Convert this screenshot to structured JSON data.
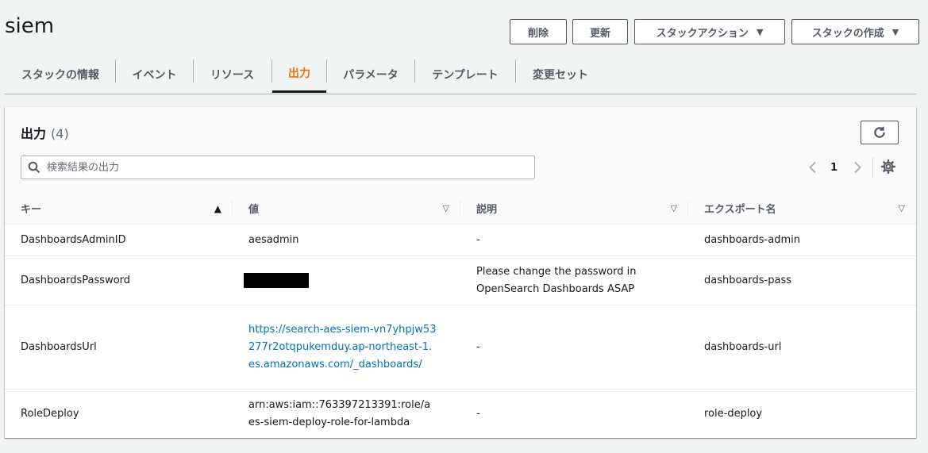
{
  "page": {
    "title": "siem"
  },
  "actions": {
    "delete": "削除",
    "update": "更新",
    "stack_actions": "スタックアクション",
    "create_stack": "スタックの作成"
  },
  "tabs": [
    {
      "label": "スタックの情報",
      "active": false
    },
    {
      "label": "イベント",
      "active": false
    },
    {
      "label": "リソース",
      "active": false
    },
    {
      "label": "出力",
      "active": true
    },
    {
      "label": "パラメータ",
      "active": false
    },
    {
      "label": "テンプレート",
      "active": false
    },
    {
      "label": "変更セット",
      "active": false
    }
  ],
  "outputs_panel": {
    "title": "出力",
    "count": "(4)",
    "search_placeholder": "検索結果の出力",
    "page_number": "1",
    "columns": {
      "key": "キー",
      "value": "値",
      "description": "説明",
      "export_name": "エクスポート名"
    },
    "rows": [
      {
        "key": "DashboardsAdminID",
        "value": "aesadmin",
        "description": "-",
        "export_name": "dashboards-admin"
      },
      {
        "key": "DashboardsPassword",
        "value": "",
        "description": "Please change the password in OpenSearch Dashboards ASAP",
        "export_name": "dashboards-pass"
      },
      {
        "key": "DashboardsUrl",
        "value": "https://search-aes-siem-vn7yhpjw53277r2otqpukemduy.ap-northeast-1.es.amazonaws.com/_dashboards/",
        "description": "-",
        "export_name": "dashboards-url"
      },
      {
        "key": "RoleDeploy",
        "value": "arn:aws:iam::763397213391:role/aes-siem-deploy-role-for-lambda",
        "description": "-",
        "export_name": "role-deploy"
      }
    ]
  },
  "colors": {
    "accent": "#ec7211",
    "link": "#0073bb",
    "text": "#16191f",
    "secondary_text": "#545b64",
    "background": "#f2f3f3"
  },
  "icons": {
    "refresh": "refresh-icon",
    "search": "search-icon",
    "prev": "chevron-left-icon",
    "next": "chevron-right-icon",
    "settings": "gear-icon",
    "sort_asc": "sort-ascending-icon",
    "sort": "sort-icon",
    "dropdown": "caret-down-icon"
  }
}
